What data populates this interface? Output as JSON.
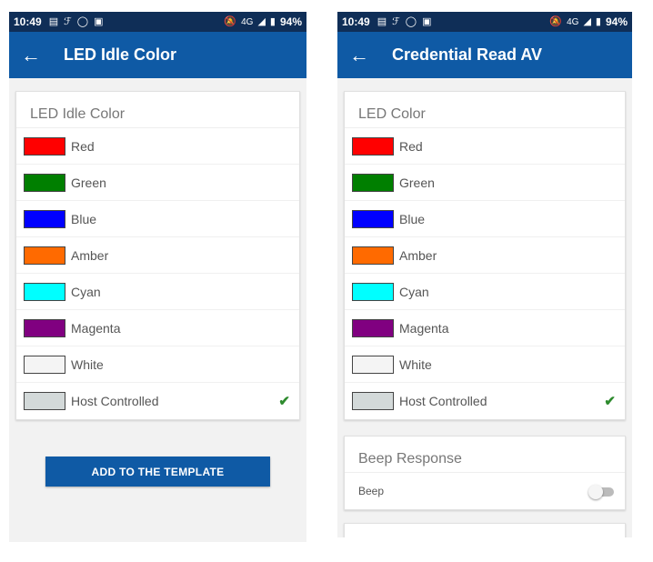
{
  "left": {
    "status": {
      "time": "10:49",
      "network": "4G",
      "battery": "94%"
    },
    "app_bar": {
      "title": "LED Idle Color"
    },
    "card": {
      "header": "LED Idle Color",
      "options": [
        {
          "label": "Red",
          "color": "#ff0000"
        },
        {
          "label": "Green",
          "color": "#007f00"
        },
        {
          "label": "Blue",
          "color": "#0000ff"
        },
        {
          "label": "Amber",
          "color": "#ff6a00"
        },
        {
          "label": "Cyan",
          "color": "#00ffff"
        },
        {
          "label": "Magenta",
          "color": "#800080"
        },
        {
          "label": "White",
          "color": "#f4f4f4"
        },
        {
          "label": "Host Controlled",
          "color": "#d3d9d9",
          "selected": true
        }
      ]
    },
    "button": {
      "label": "ADD TO THE TEMPLATE"
    }
  },
  "right": {
    "status": {
      "time": "10:49",
      "network": "4G",
      "battery": "94%"
    },
    "app_bar": {
      "title": "Credential Read AV"
    },
    "card": {
      "header": "LED Color",
      "options": [
        {
          "label": "Red",
          "color": "#ff0000"
        },
        {
          "label": "Green",
          "color": "#007f00"
        },
        {
          "label": "Blue",
          "color": "#0000ff"
        },
        {
          "label": "Amber",
          "color": "#ff6a00"
        },
        {
          "label": "Cyan",
          "color": "#00ffff"
        },
        {
          "label": "Magenta",
          "color": "#800080"
        },
        {
          "label": "White",
          "color": "#f4f4f4"
        },
        {
          "label": "Host Controlled",
          "color": "#d3d9d9",
          "selected": true
        }
      ]
    },
    "beep_card": {
      "header": "Beep Response",
      "row_label": "Beep",
      "toggle_on": false
    }
  },
  "colors": {
    "status_bar": "#0f2e57",
    "app_bar": "#0f5aa5",
    "button": "#0f5aa5",
    "check": "#2e8b2e"
  }
}
